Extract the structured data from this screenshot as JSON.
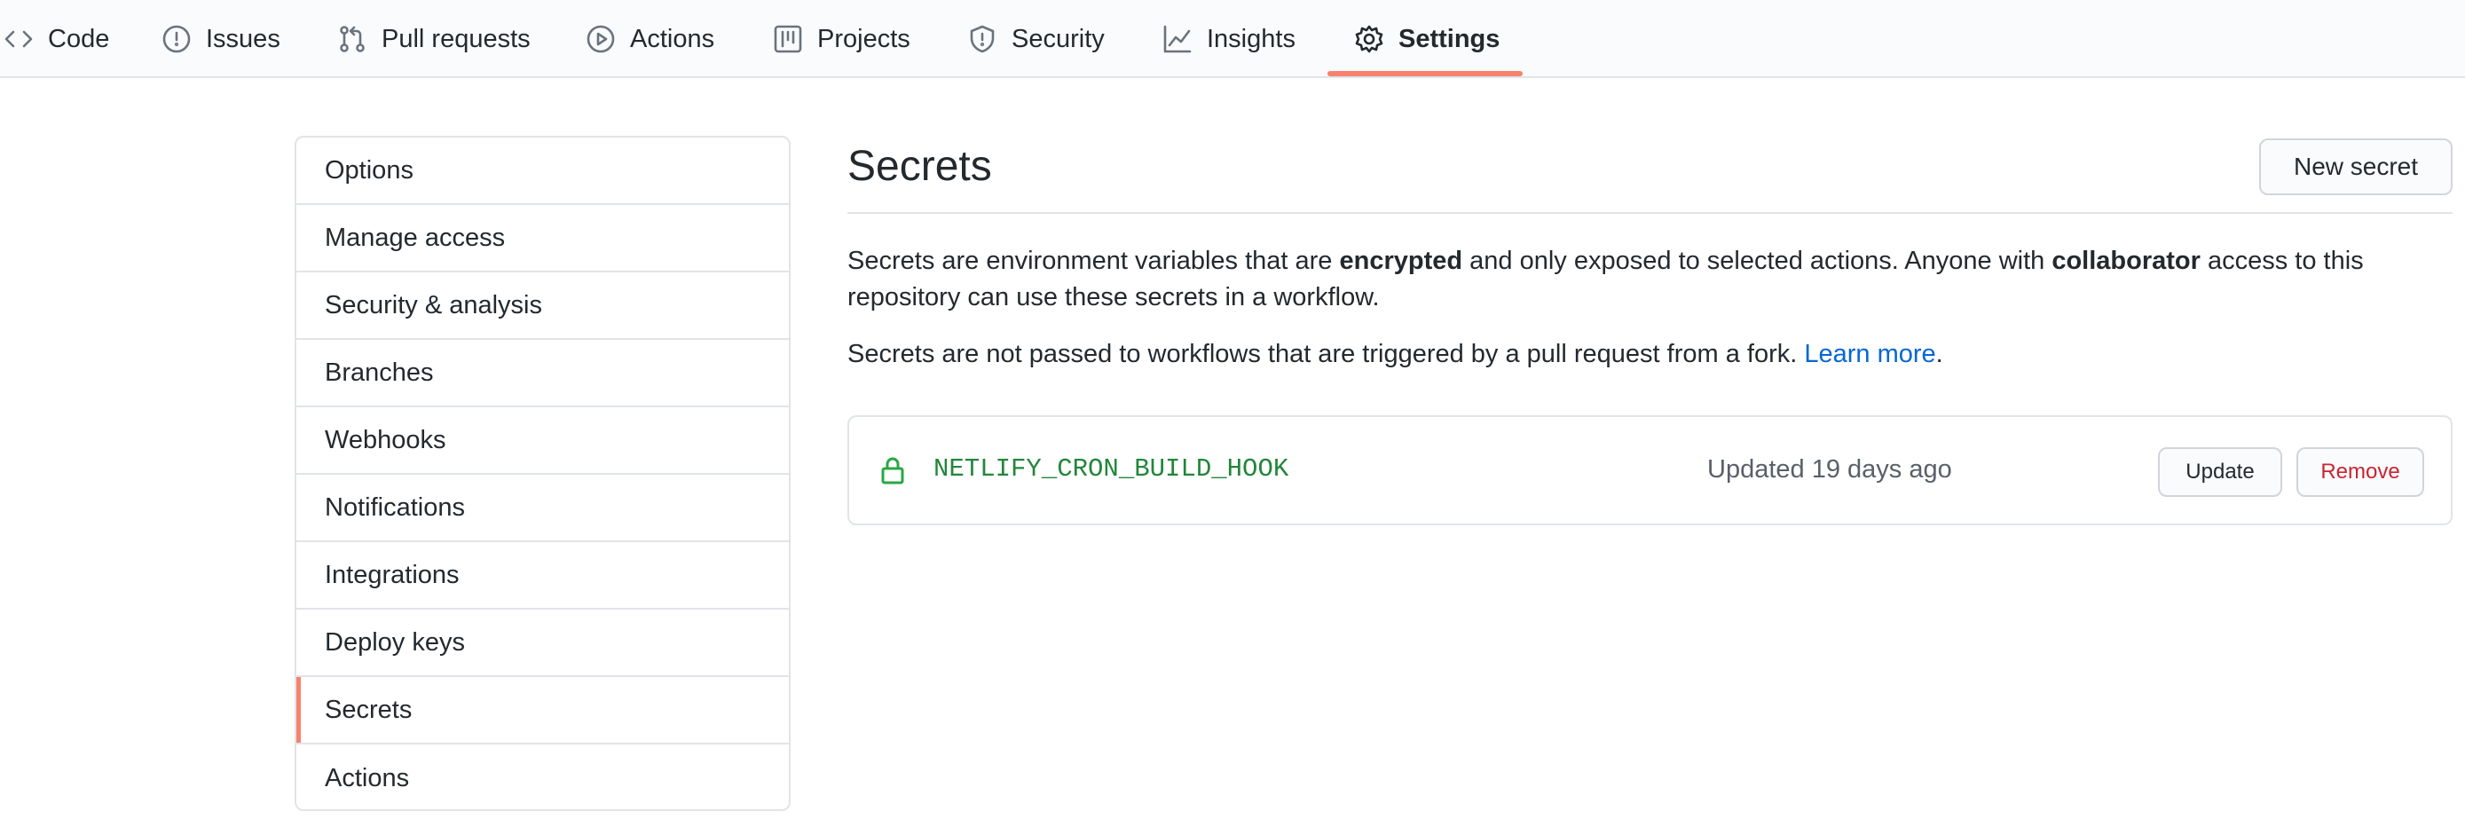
{
  "repo_nav": {
    "tabs": [
      {
        "label": "Code",
        "icon": "code-icon"
      },
      {
        "label": "Issues",
        "icon": "issue-opened-icon"
      },
      {
        "label": "Pull requests",
        "icon": "git-pull-request-icon"
      },
      {
        "label": "Actions",
        "icon": "play-icon"
      },
      {
        "label": "Projects",
        "icon": "project-icon"
      },
      {
        "label": "Security",
        "icon": "shield-icon"
      },
      {
        "label": "Insights",
        "icon": "graph-icon"
      },
      {
        "label": "Settings",
        "icon": "gear-icon",
        "selected": true
      }
    ],
    "selected_underline_color": "#f9826c"
  },
  "sidebar": {
    "items": [
      {
        "label": "Options"
      },
      {
        "label": "Manage access"
      },
      {
        "label": "Security & analysis"
      },
      {
        "label": "Branches"
      },
      {
        "label": "Webhooks"
      },
      {
        "label": "Notifications"
      },
      {
        "label": "Integrations"
      },
      {
        "label": "Deploy keys"
      },
      {
        "label": "Secrets",
        "active": true
      },
      {
        "label": "Actions"
      }
    ]
  },
  "main": {
    "title": "Secrets",
    "new_secret_label": "New secret",
    "description": {
      "p1_part1": "Secrets are environment variables that are ",
      "p1_bold1": "encrypted",
      "p1_part2": " and only exposed to selected actions. Anyone with ",
      "p1_bold2": "collaborator",
      "p1_part3": " access to this repository can use these secrets in a workflow.",
      "p2_text": "Secrets are not passed to workflows that are triggered by a pull request from a fork. ",
      "p2_link": "Learn more",
      "p2_end": "."
    },
    "secrets": [
      {
        "icon": "lock-icon",
        "name": "NETLIFY_CRON_BUILD_HOOK",
        "updated": "Updated 19 days ago",
        "update_label": "Update",
        "remove_label": "Remove"
      }
    ]
  },
  "colors": {
    "accent": "#f9826c",
    "link": "#0366d6",
    "secret_green": "#22863a",
    "danger": "#cb2431"
  }
}
